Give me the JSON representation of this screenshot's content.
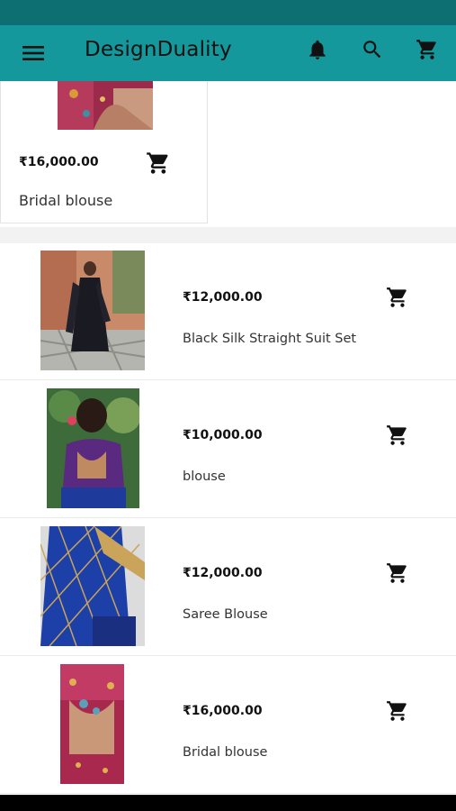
{
  "app": {
    "title": "DesignDuality"
  },
  "icons": {
    "menu": "hamburger-menu-icon",
    "bell": "notification-bell-icon",
    "search": "search-icon",
    "cart": "shopping-cart-icon"
  },
  "colors": {
    "status_bar": "#0d6f72",
    "app_bar": "#14989b"
  },
  "top_card": {
    "price": "₹16,000.00",
    "name": "Bridal blouse"
  },
  "products": [
    {
      "price": "₹12,000.00",
      "name": "Black Silk Straight Suit Set"
    },
    {
      "price": "₹10,000.00",
      "name": "blouse"
    },
    {
      "price": "₹12,000.00",
      "name": "Saree Blouse"
    },
    {
      "price": "₹16,000.00",
      "name": "Bridal blouse"
    }
  ]
}
